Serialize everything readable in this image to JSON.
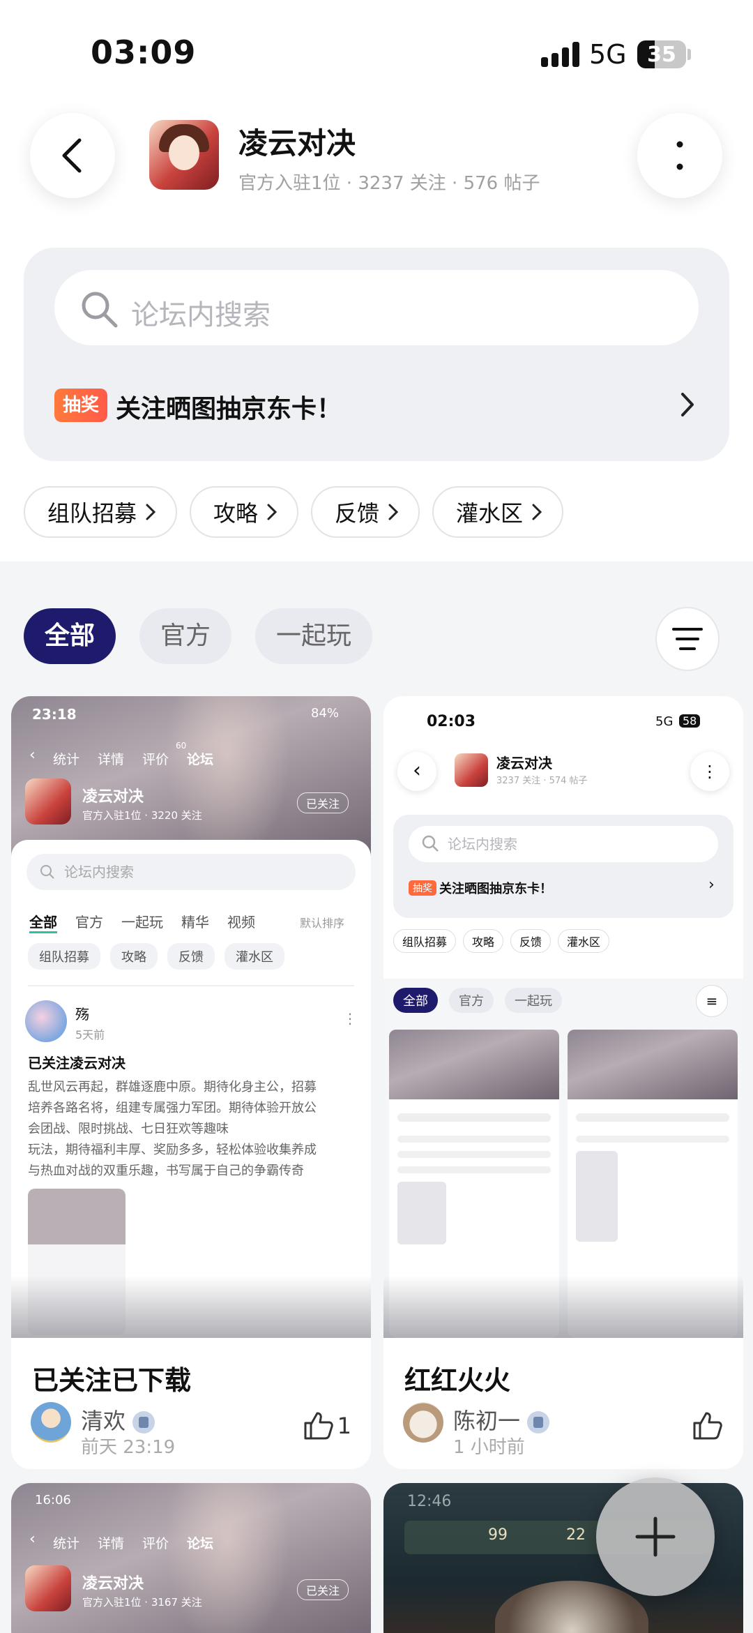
{
  "status_bar": {
    "time": "03:09",
    "network": "5G",
    "battery": "35",
    "battery_level": 0.35
  },
  "header": {
    "title": "凌云对决",
    "subtitle": "官方入驻1位 · 3237 关注 · 576 帖子"
  },
  "search": {
    "placeholder": "论坛内搜索"
  },
  "promo": {
    "badge": "抽奖",
    "text": "关注晒图抽京东卡！"
  },
  "sections": [
    "组队招募",
    "攻略",
    "反馈",
    "灌水区"
  ],
  "tabs": [
    {
      "label": "全部",
      "active": true
    },
    {
      "label": "官方",
      "active": false
    },
    {
      "label": "一起玩",
      "active": false
    }
  ],
  "posts": [
    {
      "title": "已关注已下载",
      "author": "清欢",
      "time": "前天 23:19",
      "likes": "1",
      "preview": {
        "status_time": "23:18",
        "battery": "84%",
        "nav": [
          "统计",
          "详情",
          "评价",
          "论坛"
        ],
        "review_count": "60",
        "game": "凌云对决",
        "meta": "官方入驻1位 · 3220 关注",
        "follow": "已关注",
        "search": "论坛内搜索",
        "tabs": [
          "全部",
          "官方",
          "一起玩",
          "精华",
          "视频"
        ],
        "sort": "默认排序",
        "tags": [
          "组队招募",
          "攻略",
          "反馈",
          "灌水区"
        ],
        "post_author": "殇",
        "post_time": "5天前",
        "post_title": "已关注凌云对决",
        "post_body": [
          "乱世风云再起，群雄逐鹿中原。期待化身主公，招募",
          "培养各路名将，组建专属强力军团。期待体验开放公",
          "会团战、限时挑战、七日狂欢等趣味",
          "玩法，期待福利丰厚、奖励多多，轻松体验收集养成",
          "与热血对战的双重乐趣，书写属于自己的争霸传奇"
        ]
      }
    },
    {
      "title": "红红火火",
      "author": "陈初一",
      "time": "1 小时前",
      "likes": "",
      "preview": {
        "status_time": "02:03",
        "network": "5G",
        "battery": "58",
        "game": "凌云对决",
        "meta": "3237 关注 · 574 帖子",
        "search": "论坛内搜索",
        "promo_badge": "抽奖",
        "promo": "关注晒图抽京东卡！",
        "tags": [
          "组队招募",
          "攻略",
          "反馈",
          "灌水区"
        ],
        "tabs": [
          "全部",
          "官方",
          "一起玩"
        ]
      }
    },
    {
      "preview": {
        "status_time": "16:06",
        "nav": [
          "统计",
          "详情",
          "评价",
          "论坛"
        ],
        "game": "凌云对决",
        "meta": "官方入驻1位 · 3167 关注",
        "follow": "已关注"
      }
    },
    {
      "preview": {
        "status_time": "12:46",
        "hud_value_1": "99",
        "hud_value_2": "22"
      }
    }
  ],
  "colors": {
    "active_tab": "#1f1b6c",
    "promo_badge": "#ff6a3d",
    "fab": "#c8c8c8"
  }
}
